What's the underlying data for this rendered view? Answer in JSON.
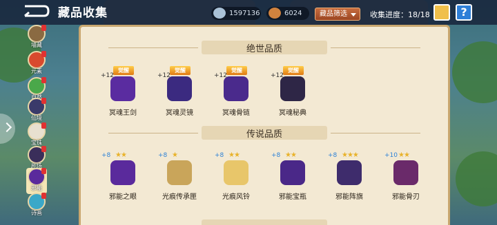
{
  "header": {
    "title": "藏品收集",
    "currency_1": "1597136",
    "currency_2": "6024",
    "filter_label": "藏品筛选",
    "progress": "收集进度：18/18",
    "help_icon_glyph": "?"
  },
  "sidebar": {
    "items": [
      {
        "label": "墙藏"
      },
      {
        "label": "元素"
      },
      {
        "label": "自然"
      },
      {
        "label": "仙境"
      },
      {
        "label": "宝珠"
      },
      {
        "label": "剧场"
      },
      {
        "label": "邪能"
      },
      {
        "label": "诗画"
      }
    ]
  },
  "sections": [
    {
      "title": "绝世品质",
      "items": [
        {
          "name": "冥魂王剑",
          "plus": "+12",
          "badge": "觉醒",
          "color": "#5a2ca0"
        },
        {
          "name": "冥魂灵镜",
          "plus": "+12",
          "badge": "觉醒",
          "color": "#3b2a80"
        },
        {
          "name": "冥魂骨链",
          "plus": "+12",
          "badge": "觉醒",
          "color": "#4a2a8c"
        },
        {
          "name": "冥魂秘典",
          "plus": "+12",
          "badge": "觉醒",
          "color": "#2e2646"
        }
      ]
    },
    {
      "title": "传说品质",
      "items": [
        {
          "name": "邪能之眼",
          "plus": "+8",
          "stars": "★★",
          "color": "#5a2a9c"
        },
        {
          "name": "光痕传承匣",
          "plus": "+8",
          "stars": "★",
          "color": "#c9a55a"
        },
        {
          "name": "光痕风铃",
          "plus": "+8",
          "stars": "★★",
          "color": "#e8c66a"
        },
        {
          "name": "邪能宝瓶",
          "plus": "+8",
          "stars": "★★",
          "color": "#4a2888"
        },
        {
          "name": "邪能阵旗",
          "plus": "+8",
          "stars": "★★★",
          "color": "#3e2c6c"
        },
        {
          "name": "邪能骨刃",
          "plus": "+10",
          "stars": "★★",
          "color": "#6a2a6a"
        }
      ]
    }
  ],
  "colors": {
    "panel_bg": "#f3e9d3",
    "panel_border": "#c9a76f",
    "filter_btn": "#b45a30",
    "topbar": "#18263c",
    "awaken_badge": "#f0a030"
  }
}
